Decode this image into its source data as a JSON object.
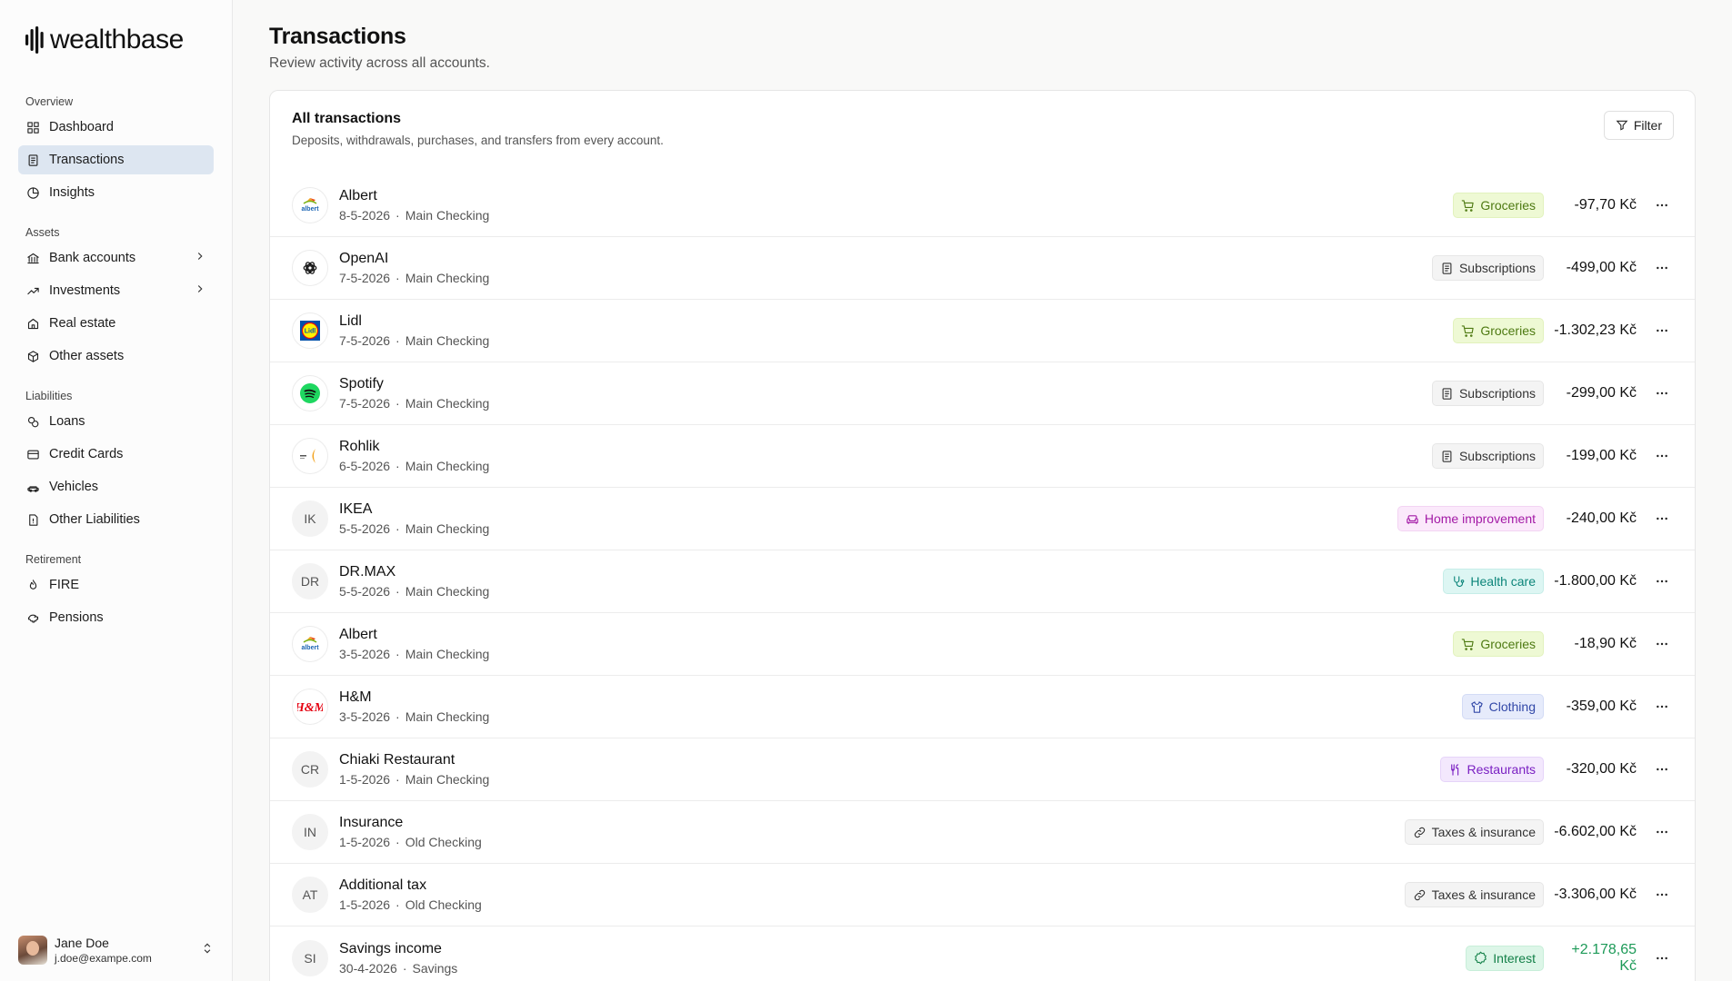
{
  "brand": {
    "name": "wealthbase"
  },
  "nav": [
    {
      "title": "Overview",
      "items": [
        {
          "label": "Dashboard",
          "icon": "grid-icon",
          "active": false,
          "chevron": false
        },
        {
          "label": "Transactions",
          "icon": "receipt-icon",
          "active": true,
          "chevron": false
        },
        {
          "label": "Insights",
          "icon": "pie-chart-icon",
          "active": false,
          "chevron": false
        }
      ]
    },
    {
      "title": "Assets",
      "items": [
        {
          "label": "Bank accounts",
          "icon": "bank-icon",
          "active": false,
          "chevron": true
        },
        {
          "label": "Investments",
          "icon": "trending-up-icon",
          "active": false,
          "chevron": true
        },
        {
          "label": "Real estate",
          "icon": "home-icon",
          "active": false,
          "chevron": false
        },
        {
          "label": "Other assets",
          "icon": "box-icon",
          "active": false,
          "chevron": false
        }
      ]
    },
    {
      "title": "Liabilities",
      "items": [
        {
          "label": "Loans",
          "icon": "coins-icon",
          "active": false,
          "chevron": false
        },
        {
          "label": "Credit Cards",
          "icon": "credit-card-icon",
          "active": false,
          "chevron": false
        },
        {
          "label": "Vehicles",
          "icon": "car-icon",
          "active": false,
          "chevron": false
        },
        {
          "label": "Other Liabilities",
          "icon": "file-alert-icon",
          "active": false,
          "chevron": false
        }
      ]
    },
    {
      "title": "Retirement",
      "items": [
        {
          "label": "FIRE",
          "icon": "flame-icon",
          "active": false,
          "chevron": false
        },
        {
          "label": "Pensions",
          "icon": "piggy-bank-icon",
          "active": false,
          "chevron": false
        }
      ]
    }
  ],
  "user": {
    "name": "Jane Doe",
    "email": "j.doe@exampe.com"
  },
  "page": {
    "title": "Transactions",
    "subtitle": "Review activity across all accounts."
  },
  "card": {
    "title": "All transactions",
    "subtitle": "Deposits, withdrawals, purchases, and transfers from every account.",
    "filter_label": "Filter"
  },
  "categories": {
    "Groceries": {
      "icon": "cart-icon",
      "bg": "#eef9d4",
      "border": "#e2f2bd",
      "fg": "#4e7a12"
    },
    "Subscriptions": {
      "icon": "receipt-icon",
      "bg": "#f4f4f4",
      "border": "#e6e6e6",
      "fg": "#333333"
    },
    "Home improvement": {
      "icon": "sofa-icon",
      "bg": "#fbe9fb",
      "border": "#f3d4f3",
      "fg": "#a31aa6"
    },
    "Health care": {
      "icon": "stethoscope-icon",
      "bg": "#ddf6f3",
      "border": "#c6ede8",
      "fg": "#0c857a"
    },
    "Clothing": {
      "icon": "shirt-icon",
      "bg": "#e6ebfb",
      "border": "#d3dbf5",
      "fg": "#3248a8"
    },
    "Restaurants": {
      "icon": "utensils-icon",
      "bg": "#f3e8fd",
      "border": "#e6d4f9",
      "fg": "#7a1fc2"
    },
    "Taxes & insurance": {
      "icon": "link-icon",
      "bg": "#f4f4f4",
      "border": "#e6e6e6",
      "fg": "#333333"
    },
    "Interest": {
      "icon": "badge-percent-icon",
      "bg": "#ddf6e8",
      "border": "#c7eed9",
      "fg": "#138048"
    }
  },
  "transactions": [
    {
      "name": "Albert",
      "date": "8-5-2026",
      "account": "Main Checking",
      "category": "Groceries",
      "amount": "-97,70 Kč",
      "logo": "albert-logo",
      "initials": ""
    },
    {
      "name": "OpenAI",
      "date": "7-5-2026",
      "account": "Main Checking",
      "category": "Subscriptions",
      "amount": "-499,00 Kč",
      "logo": "openai-logo",
      "initials": ""
    },
    {
      "name": "Lidl",
      "date": "7-5-2026",
      "account": "Main Checking",
      "category": "Groceries",
      "amount": "-1.302,23 Kč",
      "logo": "lidl-logo",
      "initials": ""
    },
    {
      "name": "Spotify",
      "date": "7-5-2026",
      "account": "Main Checking",
      "category": "Subscriptions",
      "amount": "-299,00 Kč",
      "logo": "spotify-logo",
      "initials": ""
    },
    {
      "name": "Rohlik",
      "date": "6-5-2026",
      "account": "Main Checking",
      "category": "Subscriptions",
      "amount": "-199,00 Kč",
      "logo": "rohlik-logo",
      "initials": ""
    },
    {
      "name": "IKEA",
      "date": "5-5-2026",
      "account": "Main Checking",
      "category": "Home improvement",
      "amount": "-240,00 Kč",
      "logo": "",
      "initials": "IK"
    },
    {
      "name": "DR.MAX",
      "date": "5-5-2026",
      "account": "Main Checking",
      "category": "Health care",
      "amount": "-1.800,00 Kč",
      "logo": "",
      "initials": "DR"
    },
    {
      "name": "Albert",
      "date": "3-5-2026",
      "account": "Main Checking",
      "category": "Groceries",
      "amount": "-18,90 Kč",
      "logo": "albert-logo",
      "initials": ""
    },
    {
      "name": "H&M",
      "date": "3-5-2026",
      "account": "Main Checking",
      "category": "Clothing",
      "amount": "-359,00 Kč",
      "logo": "hm-logo",
      "initials": ""
    },
    {
      "name": "Chiaki Restaurant",
      "date": "1-5-2026",
      "account": "Main Checking",
      "category": "Restaurants",
      "amount": "-320,00 Kč",
      "logo": "",
      "initials": "CR"
    },
    {
      "name": "Insurance",
      "date": "1-5-2026",
      "account": "Old Checking",
      "category": "Taxes & insurance",
      "amount": "-6.602,00 Kč",
      "logo": "",
      "initials": "IN"
    },
    {
      "name": "Additional tax",
      "date": "1-5-2026",
      "account": "Old Checking",
      "category": "Taxes & insurance",
      "amount": "-3.306,00 Kč",
      "logo": "",
      "initials": "AT"
    },
    {
      "name": "Savings income",
      "date": "30-4-2026",
      "account": "Savings",
      "category": "Interest",
      "amount": "+2.178,65 Kč",
      "logo": "",
      "initials": "SI"
    }
  ]
}
